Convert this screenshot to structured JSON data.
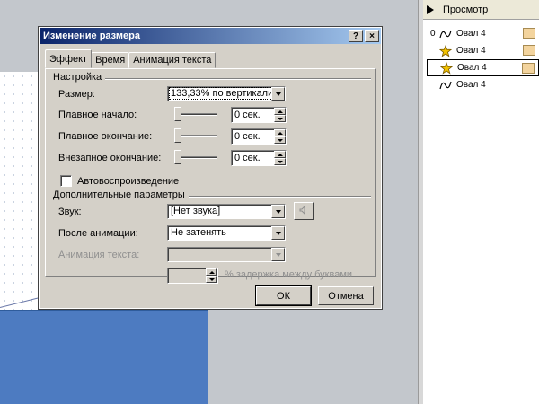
{
  "task_pane": {
    "preview_label": "Просмотр",
    "items": [
      {
        "num": "0",
        "icon": "motion-path-icon",
        "label": "Овал 4"
      },
      {
        "num": "",
        "icon": "star-effect-icon",
        "label": "Овал 4"
      },
      {
        "num": "",
        "icon": "star-effect-icon",
        "label": "Овал 4"
      },
      {
        "num": "",
        "icon": "motion-path-icon",
        "label": "Овал 4"
      }
    ]
  },
  "dialog": {
    "title": "Изменение размера",
    "help_btn": "?",
    "close_btn": "×",
    "tabs": [
      "Эффект",
      "Время",
      "Анимация текста"
    ],
    "settings_group": "Настройка",
    "size_label": "Размер:",
    "size_value": "133,33% по вертикали",
    "smooth_start_label": "Плавное начало:",
    "smooth_start_value": "0 сек.",
    "smooth_end_label": "Плавное окончание:",
    "smooth_end_value": "0 сек.",
    "sudden_end_label": "Внезапное окончание:",
    "sudden_end_value": "0 сек.",
    "autoreverse_label": "Автовоспроизведение",
    "extra_group": "Дополнительные параметры",
    "sound_label": "Звук:",
    "sound_value": "[Нет звука]",
    "after_anim_label": "После анимации:",
    "after_anim_value": "Не затенять",
    "text_anim_label": "Анимация текста:",
    "text_anim_value": "",
    "delay_value": "",
    "delay_label": "% задержка между буквами",
    "ok_label": "ОК",
    "cancel_label": "Отмена"
  }
}
